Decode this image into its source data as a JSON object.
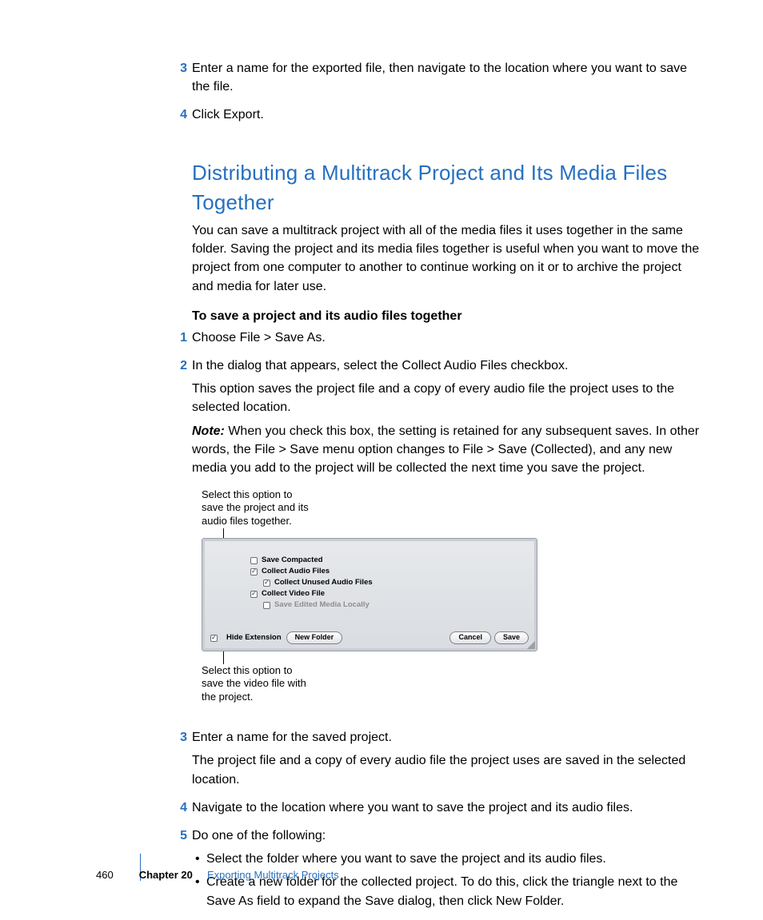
{
  "top_steps": [
    {
      "num": "3",
      "text": "Enter a name for the exported file, then navigate to the location where you want to save the file."
    },
    {
      "num": "4",
      "text": "Click Export."
    }
  ],
  "section_heading": "Distributing a Multitrack Project and Its Media Files Together",
  "intro": "You can save a multitrack project with all of the media files it uses together in the same folder. Saving the project and its media files together is useful when you want to move the project from one computer to another to continue working on it or to archive the project and media for later use.",
  "subhead": "To save a project and its audio files together",
  "mid_steps": [
    {
      "num": "1",
      "paras": [
        "Choose File > Save As."
      ]
    },
    {
      "num": "2",
      "paras": [
        "In the dialog that appears, select the Collect Audio Files checkbox.",
        "This option saves the project file and a copy of every audio file the project uses to the selected location.",
        {
          "note": true,
          "text": "When you check this box, the setting is retained for any subsequent saves. In other words, the File > Save menu option changes to File > Save (Collected), and any new media you add to the project will be collected the next time you save the project."
        }
      ]
    }
  ],
  "callout_top": "Select this option to save the project and its audio files together.",
  "callout_bottom": "Select this option to save the video file with the project.",
  "dialog": {
    "options": [
      {
        "label": "Save Compacted",
        "checked": false,
        "indent": false,
        "disabled": false
      },
      {
        "label": "Collect Audio Files",
        "checked": true,
        "indent": false,
        "disabled": false
      },
      {
        "label": "Collect Unused Audio Files",
        "checked": true,
        "indent": true,
        "disabled": false
      },
      {
        "label": "Collect Video File",
        "checked": true,
        "indent": false,
        "disabled": false
      },
      {
        "label": "Save Edited Media Locally",
        "checked": false,
        "indent": true,
        "disabled": true
      }
    ],
    "hide_ext": "Hide Extension",
    "new_folder": "New Folder",
    "cancel": "Cancel",
    "save": "Save"
  },
  "lower_steps": [
    {
      "num": "3",
      "paras": [
        "Enter a name for the saved project.",
        "The project file and a copy of every audio file the project uses are saved in the selected location."
      ]
    },
    {
      "num": "4",
      "paras": [
        "Navigate to the location where you want to save the project and its audio files."
      ]
    },
    {
      "num": "5",
      "paras": [
        "Do one of the following:"
      ],
      "bullets": [
        "Select the folder where you want to save the project and its audio files.",
        "Create a new folder for the collected project. To do this, click the triangle next to the Save As field to expand the Save dialog, then click New Folder."
      ]
    }
  ],
  "footer": {
    "page": "460",
    "chapter": "Chapter 20",
    "title": "Exporting Multitrack Projects"
  },
  "note_label": "Note:  "
}
